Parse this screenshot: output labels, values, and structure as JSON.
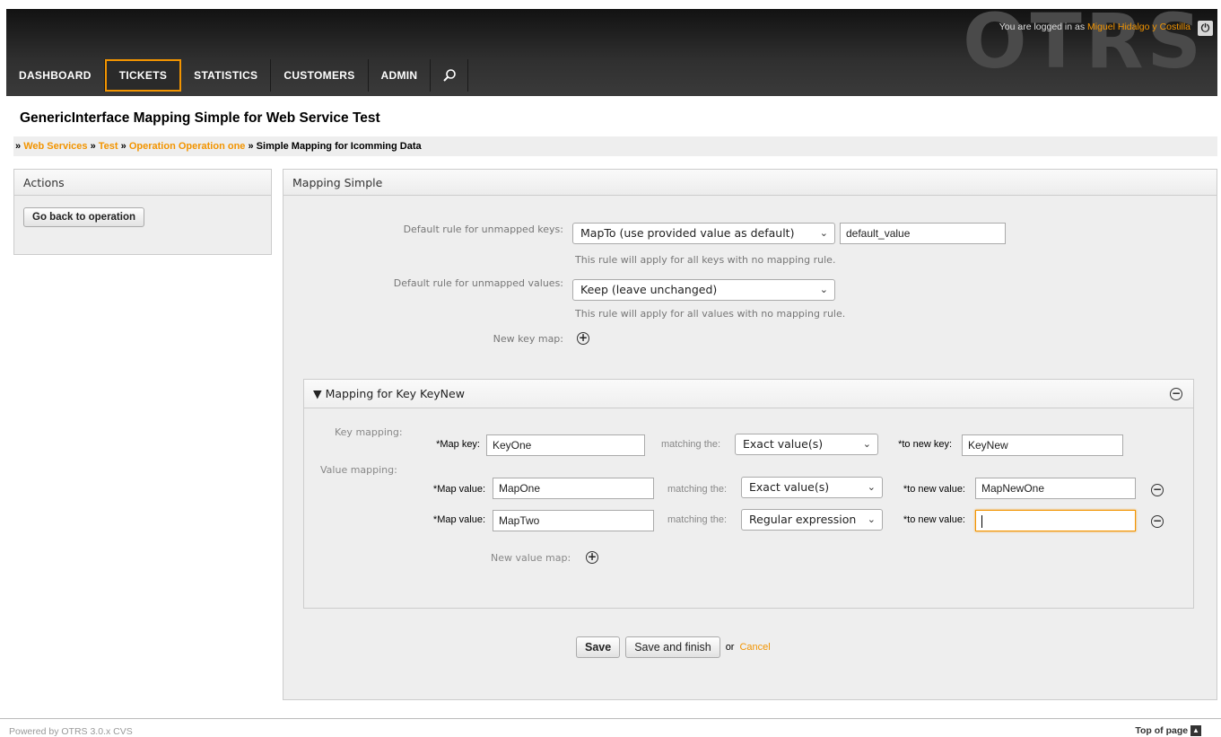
{
  "header": {
    "brand": "OTRS",
    "login_prefix": "You are logged in as",
    "user_name": "Miguel Hidalgo y Costilla",
    "logout_icon": "power-icon",
    "nav": [
      "DASHBOARD",
      "TICKETS",
      "STATISTICS",
      "CUSTOMERS",
      "ADMIN"
    ],
    "active_nav": "TICKETS",
    "search_icon": "search-icon"
  },
  "page": {
    "title": "GenericInterface Mapping Simple for Web Service Test",
    "breadcrumb": {
      "sep": "»",
      "link1": "Web Services",
      "link2": "Test",
      "link3": "Operation Operation one",
      "current": "Simple Mapping for Icomming Data"
    }
  },
  "sidebar": {
    "title": "Actions",
    "button": "Go back to operation"
  },
  "main": {
    "title": "Mapping Simple",
    "default_keys_label": "Default rule for unmapped keys:",
    "default_keys_select": "MapTo (use provided value as default)",
    "default_keys_value": "default_value",
    "default_keys_hint": "This rule will apply for all keys with no mapping rule.",
    "default_values_label": "Default rule for unmapped values:",
    "default_values_select": "Keep (leave unchanged)",
    "default_values_hint": "This rule will apply for all values with no mapping rule.",
    "new_key_map_label": "New key map:",
    "save": "Save",
    "save_finish": "Save and finish",
    "or": "or",
    "cancel": "Cancel"
  },
  "key_box": {
    "title": "Mapping for Key KeyNew",
    "toggle": "▼",
    "key_mapping_label": "Key mapping:",
    "value_mapping_label": "Value mapping:",
    "map_key_label": "Map key:",
    "map_key_value": "KeyOne",
    "matching_label": "matching the:",
    "key_match_select": "Exact value(s)",
    "to_new_key_label": "to new key:",
    "new_key_value": "KeyNew",
    "map_value_label": "Map value:",
    "to_new_value_label": "to new value:",
    "rows": [
      {
        "map_value": "MapOne",
        "match": "Exact value(s)",
        "new_value": "MapNewOne"
      },
      {
        "map_value": "MapTwo",
        "match": "Regular expression",
        "new_value": ""
      }
    ],
    "new_value_map_label": "New value map:",
    "required_mark": "*"
  },
  "footer": {
    "powered": "Powered by OTRS 3.0.x CVS",
    "top": "Top of page"
  }
}
